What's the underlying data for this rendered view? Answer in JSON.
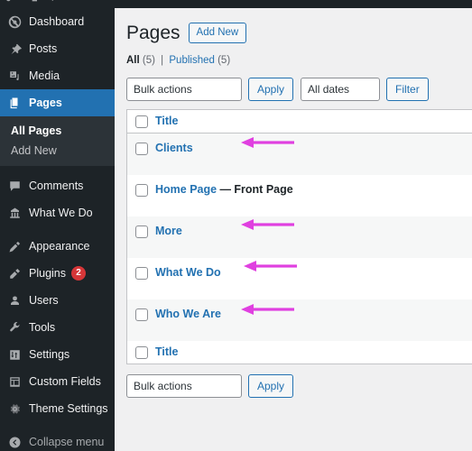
{
  "adminbar": {
    "icons": [
      "wordpress-logo-icon",
      "comment-bubble-icon",
      "plus-icon"
    ]
  },
  "sidebar": {
    "items": [
      {
        "label": "Dashboard",
        "icon": "dashboard-icon",
        "current": false
      },
      {
        "label": "Posts",
        "icon": "pin-icon",
        "current": false
      },
      {
        "label": "Media",
        "icon": "media-icon",
        "current": false
      },
      {
        "label": "Pages",
        "icon": "pages-icon",
        "current": true
      },
      {
        "label": "Comments",
        "icon": "comment-icon",
        "current": false
      },
      {
        "label": "What We Do",
        "icon": "custom-post-type-icon",
        "current": false
      },
      {
        "label": "Appearance",
        "icon": "appearance-brush-icon",
        "current": false
      },
      {
        "label": "Plugins",
        "icon": "plugins-plug-icon",
        "current": false,
        "badge": "2"
      },
      {
        "label": "Users",
        "icon": "users-icon",
        "current": false
      },
      {
        "label": "Tools",
        "icon": "tools-wrench-icon",
        "current": false
      },
      {
        "label": "Settings",
        "icon": "settings-sliders-icon",
        "current": false
      },
      {
        "label": "Custom Fields",
        "icon": "custom-fields-icon",
        "current": false
      },
      {
        "label": "Theme Settings",
        "icon": "gear-icon",
        "current": false
      },
      {
        "label": "Collapse menu",
        "icon": "collapse-arrow-icon",
        "current": false
      }
    ],
    "submenu": [
      {
        "label": "All Pages",
        "current": true
      },
      {
        "label": "Add New",
        "current": false
      }
    ]
  },
  "header": {
    "title": "Pages",
    "add_new_label": "Add New"
  },
  "filters": {
    "all_label": "All",
    "all_count": "(5)",
    "divider": "|",
    "published_label": "Published",
    "published_count": "(5)"
  },
  "tablenav_top": {
    "bulk_actions_value": "Bulk actions",
    "apply_label": "Apply",
    "dates_value": "All dates",
    "filter_label": "Filter"
  },
  "tablenav_bottom": {
    "bulk_actions_value": "Bulk actions",
    "apply_label": "Apply"
  },
  "table": {
    "column_header": "Title",
    "column_footer": "Title",
    "rows": [
      {
        "title": "Clients",
        "state": "",
        "arrow": true
      },
      {
        "title": "Home Page",
        "state": "— Front Page",
        "arrow": false
      },
      {
        "title": "More",
        "state": "",
        "arrow": true
      },
      {
        "title": "What We Do",
        "state": "",
        "arrow": true
      },
      {
        "title": "Who We Are",
        "state": "",
        "arrow": true
      }
    ]
  },
  "annotations": {
    "arrow_color": "#e040e0",
    "count": 4
  }
}
